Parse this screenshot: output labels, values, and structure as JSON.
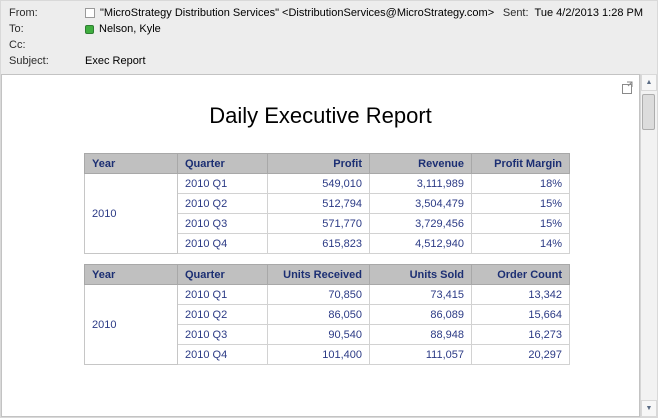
{
  "header": {
    "from_label": "From:",
    "from_value": "\"MicroStrategy Distribution Services\" <DistributionServices@MicroStrategy.com>",
    "sent_label": "Sent:",
    "sent_value": "Tue 4/2/2013 1:28 PM",
    "to_label": "To:",
    "to_value": "Nelson, Kyle",
    "cc_label": "Cc:",
    "cc_value": "",
    "subject_label": "Subject:",
    "subject_value": "Exec Report"
  },
  "body": {
    "title": "Daily Executive Report",
    "tables": [
      {
        "headers": [
          "Year",
          "Quarter",
          "Profit",
          "Revenue",
          "Profit Margin"
        ],
        "year": "2010",
        "rows": [
          [
            "2010 Q1",
            "549,010",
            "3,111,989",
            "18%"
          ],
          [
            "2010 Q2",
            "512,794",
            "3,504,479",
            "15%"
          ],
          [
            "2010 Q3",
            "571,770",
            "3,729,456",
            "15%"
          ],
          [
            "2010 Q4",
            "615,823",
            "4,512,940",
            "14%"
          ]
        ]
      },
      {
        "headers": [
          "Year",
          "Quarter",
          "Units Received",
          "Units Sold",
          "Order Count"
        ],
        "year": "2010",
        "rows": [
          [
            "2010 Q1",
            "70,850",
            "73,415",
            "13,342"
          ],
          [
            "2010 Q2",
            "86,050",
            "86,089",
            "15,664"
          ],
          [
            "2010 Q3",
            "90,540",
            "88,948",
            "16,273"
          ],
          [
            "2010 Q4",
            "101,400",
            "111,057",
            "20,297"
          ]
        ]
      }
    ]
  },
  "icons": {
    "scroll_up": "▲",
    "scroll_down": "▼"
  },
  "colors": {
    "table_header_bg": "#C0C0C0",
    "table_header_text": "#1C2F73",
    "table_data_text": "#2B3A85",
    "presence_green": "#3FAE3F"
  }
}
